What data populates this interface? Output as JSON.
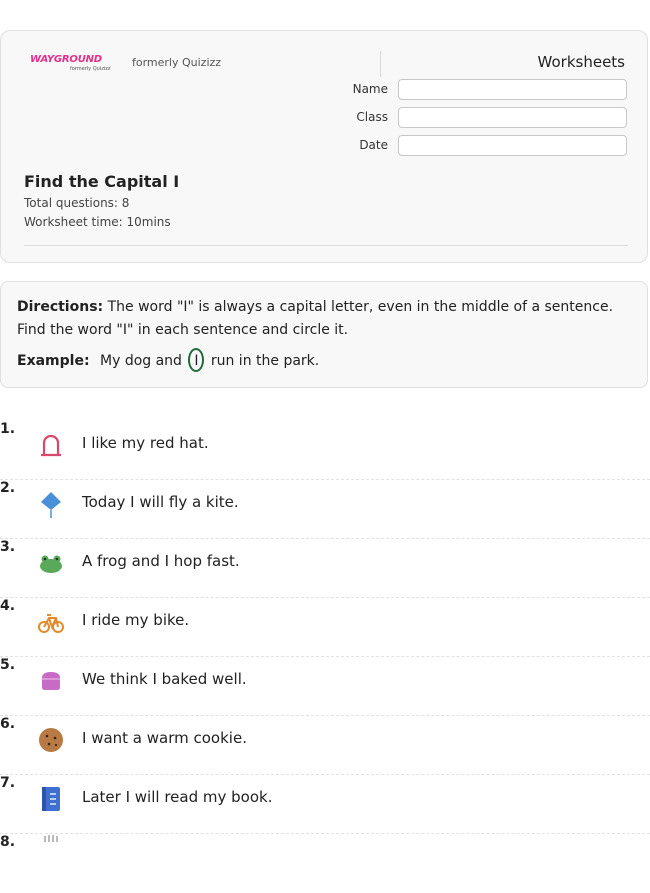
{
  "header": {
    "logo_text": "WAYGROUND",
    "logo_sub": "formerly Quizizz",
    "formerly": "formerly Quizizz",
    "worksheets_label": "Worksheets",
    "fields": [
      {
        "label": "Name",
        "value": ""
      },
      {
        "label": "Class",
        "value": ""
      },
      {
        "label": "Date",
        "value": ""
      }
    ],
    "title": "Find the Capital I",
    "total_questions": "Total questions: 8",
    "worksheet_time": "Worksheet time: 10mins"
  },
  "directions": {
    "label": "Directions:",
    "text": " The word \"I\" is always a capital letter, even in the middle of a sentence. Find the word \"I\" in each sentence and circle it.",
    "example_label": "Example:",
    "example_before": "My dog and",
    "example_circled": "I",
    "example_after": "run in the park."
  },
  "questions": [
    {
      "num": "1.",
      "text": "I like my red hat.",
      "icon": "hat-icon"
    },
    {
      "num": "2.",
      "text": "Today I will fly a kite.",
      "icon": "kite-icon"
    },
    {
      "num": "3.",
      "text": "A frog and I hop fast.",
      "icon": "frog-icon"
    },
    {
      "num": "4.",
      "text": "I ride my bike.",
      "icon": "bike-icon"
    },
    {
      "num": "5.",
      "text": "We think I baked well.",
      "icon": "cake-icon"
    },
    {
      "num": "6.",
      "text": "I want a warm cookie.",
      "icon": "cookie-icon"
    },
    {
      "num": "7.",
      "text": "Later I will read my book.",
      "icon": "book-icon"
    },
    {
      "num": "8.",
      "text": "",
      "icon": "glove-icon"
    }
  ],
  "colors": {
    "brand": "#e52f8a",
    "circle": "#1f6b3a",
    "hat": "#d9486a",
    "kite": "#4a90d9",
    "frog": "#5aa85a",
    "bike": "#e38b2c",
    "cake": "#c86bc4",
    "cookie": "#b87a45",
    "book": "#3f6fd1"
  }
}
